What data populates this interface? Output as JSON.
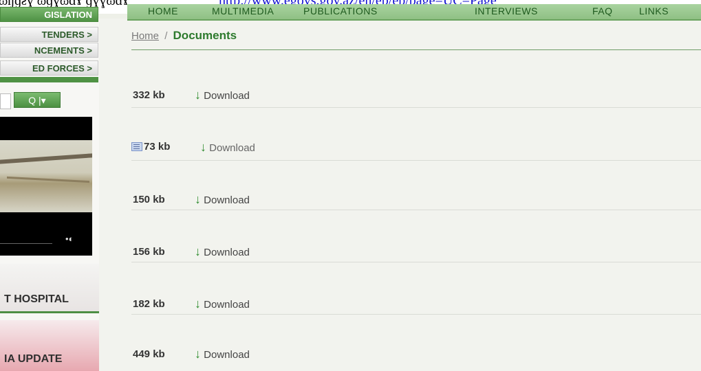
{
  "top": {
    "garble": "ɷŋɡƨɣ  ɷɡɣɷɑɤ  ɡɣɣɷɑɤ",
    "url": "http://www.egovs.gov.az/en/ep/ep/page=UC=Page"
  },
  "nav": {
    "items": [
      "HOME",
      "MULTIMEDIA",
      "PUBLICATIONS",
      "INTERVIEWS",
      "FAQ",
      "LINKS"
    ]
  },
  "sidebar": {
    "items": [
      "GISLATION",
      "TENDERS >",
      "NCEMENTS >",
      "ED FORCES >"
    ],
    "search_icon": "search-icon",
    "search_label": "Q |▾"
  },
  "banners": {
    "hospital": "T HOSPITAL",
    "media": "IA UPDATE"
  },
  "breadcrumb": {
    "home": "Home",
    "separator": "/",
    "current": "Documents"
  },
  "documents": [
    {
      "size": "332 kb",
      "label": "Download",
      "icon": null
    },
    {
      "size": "73 kb",
      "label": "Download",
      "icon": "doc-icon"
    },
    {
      "size": "150 kb",
      "label": "Download",
      "icon": null
    },
    {
      "size": "156 kb",
      "label": "Download",
      "icon": null
    },
    {
      "size": "182 kb",
      "label": "Download",
      "icon": null
    },
    {
      "size": "449 kb",
      "label": "Download",
      "icon": null
    }
  ],
  "colors": {
    "accent": "#2d7a2d",
    "nav_bg": "#9ccb91"
  }
}
